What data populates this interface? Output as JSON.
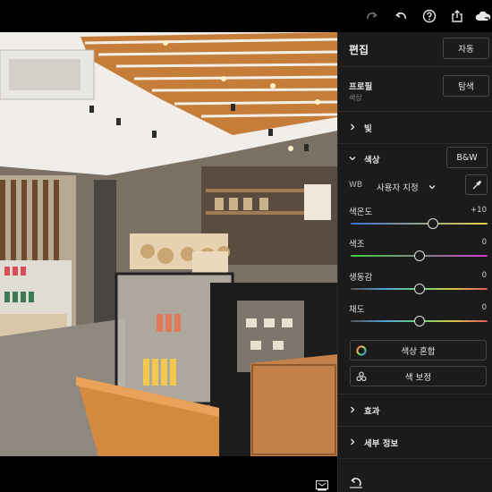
{
  "toolbar": {
    "icons": [
      "redo-icon",
      "undo-icon",
      "help-icon",
      "share-icon",
      "cloud-sync-icon"
    ]
  },
  "panel": {
    "title": "편집",
    "auto_label": "자동",
    "profile": {
      "label": "프로필",
      "value": "색상",
      "browse_label": "탐색"
    },
    "sections": {
      "light": "빛",
      "color": "색상",
      "effects": "효과",
      "detail": "세부 정보"
    },
    "bw_label": "B&W",
    "wb": {
      "label": "WB",
      "value": "사용자 지정"
    },
    "sliders": [
      {
        "label": "색온도",
        "value": "+10",
        "fraction": 0.6
      },
      {
        "label": "색조",
        "value": "0",
        "fraction": 0.5
      },
      {
        "label": "생동감",
        "value": "0",
        "fraction": 0.5
      },
      {
        "label": "채도",
        "value": "0",
        "fraction": 0.5
      }
    ],
    "color_mix_label": "색상 혼합",
    "color_grading_label": "색 보정"
  },
  "colors": {
    "panel_bg": "#1b1b1b",
    "temp_track": [
      "#3b6fd6",
      "#e8d24a"
    ],
    "tint_track": [
      "#3bd13b",
      "#d13bd1"
    ]
  }
}
